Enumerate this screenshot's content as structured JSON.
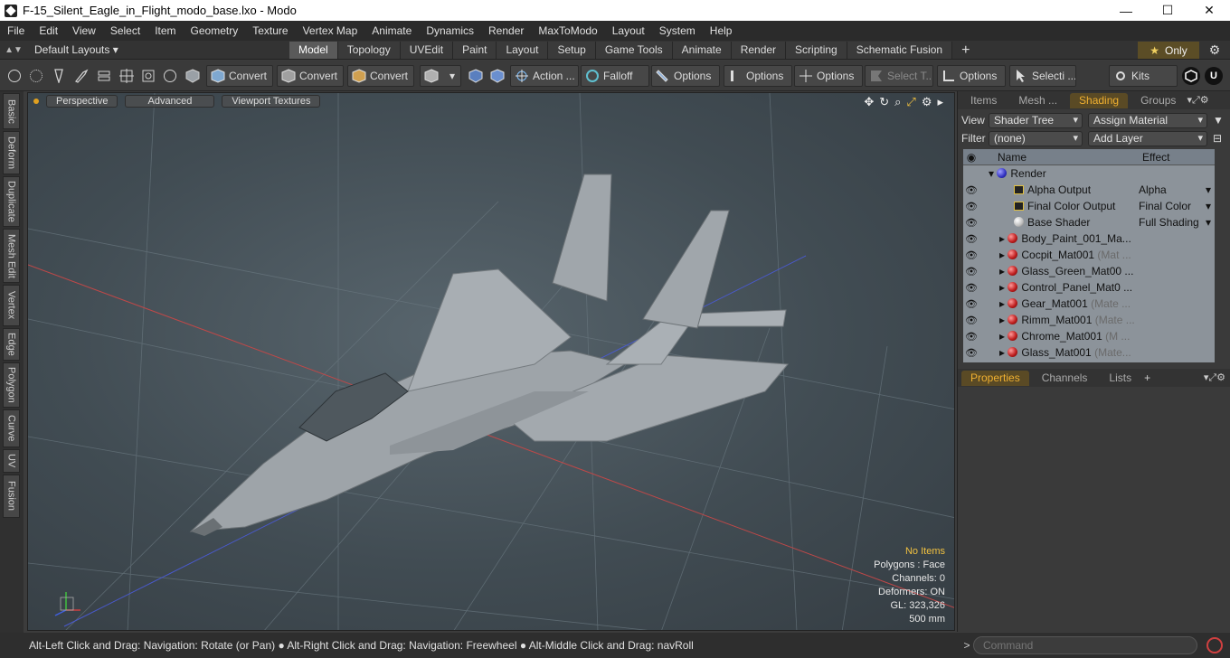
{
  "window": {
    "title": "F-15_Silent_Eagle_in_Flight_modo_base.lxo - Modo",
    "min": "—",
    "max": "☐",
    "close": "✕"
  },
  "menu": [
    "File",
    "Edit",
    "View",
    "Select",
    "Item",
    "Geometry",
    "Texture",
    "Vertex Map",
    "Animate",
    "Dynamics",
    "Render",
    "MaxToModo",
    "Layout",
    "System",
    "Help"
  ],
  "layouts": {
    "selector": "Default Layouts ▾",
    "tabs": [
      "Model",
      "Topology",
      "UVEdit",
      "Paint",
      "Layout",
      "Setup",
      "Game Tools",
      "Animate",
      "Render",
      "Scripting",
      "Schematic Fusion"
    ],
    "active": "Model",
    "only_label": "Only"
  },
  "toolbar": {
    "convert1": "Convert",
    "convert2": "Convert",
    "convert3": "Convert",
    "action": "Action  ...",
    "falloff": "Falloff",
    "options1": "Options",
    "options2": "Options",
    "options3": "Options",
    "select_t": "Select T...",
    "options4": "Options",
    "selecti": "Selecti ...",
    "kits": "Kits"
  },
  "left_tabs": [
    "Basic",
    "Deform",
    "Duplicate",
    "Mesh Edit",
    "Vertex",
    "Edge",
    "Polygon",
    "Curve",
    "UV",
    "Fusion"
  ],
  "viewport": {
    "perspective": "Perspective",
    "advanced": "Advanced",
    "textures": "Viewport Textures",
    "info": {
      "items": "No Items",
      "polygons": "Polygons : Face",
      "channels": "Channels: 0",
      "deformers": "Deformers: ON",
      "gl": "GL: 323,326",
      "scale": "500 mm"
    }
  },
  "status": {
    "hint": "Alt-Left Click and Drag: Navigation: Rotate (or Pan) ● Alt-Right Click and Drag: Navigation: Freewheel ● Alt-Middle Click and Drag: navRoll",
    "command_placeholder": "Command"
  },
  "right_panel": {
    "tabs": [
      "Items",
      "Mesh ...",
      "Shading",
      "Groups"
    ],
    "active_tab": "Shading",
    "view_label": "View",
    "view_value": "Shader Tree",
    "assign_material": "Assign Material",
    "filter_label": "Filter",
    "filter_value": "(none)",
    "add_layer": "Add Layer",
    "col_name": "Name",
    "col_effect": "Effect",
    "rows": [
      {
        "name": "Render",
        "effect": "",
        "icon": "render",
        "indent": 0
      },
      {
        "name": "Alpha Output",
        "effect": "Alpha",
        "icon": "output",
        "indent": 1
      },
      {
        "name": "Final Color Output",
        "effect": "Final Color",
        "icon": "output",
        "indent": 1
      },
      {
        "name": "Base Shader",
        "effect": "Full Shading",
        "icon": "shader",
        "indent": 1
      },
      {
        "name": "Body_Paint_001_Ma...",
        "effect": "",
        "icon": "material",
        "indent": 1
      },
      {
        "name": "Cocpit_Mat001",
        "dim": "(Mat ...",
        "effect": "",
        "icon": "material",
        "indent": 1
      },
      {
        "name": "Glass_Green_Mat00 ...",
        "effect": "",
        "icon": "material",
        "indent": 1
      },
      {
        "name": "Control_Panel_Mat0 ...",
        "effect": "",
        "icon": "material",
        "indent": 1
      },
      {
        "name": "Gear_Mat001",
        "dim": "(Mate ...",
        "effect": "",
        "icon": "material",
        "indent": 1
      },
      {
        "name": "Rimm_Mat001",
        "dim": "(Mate ...",
        "effect": "",
        "icon": "material",
        "indent": 1
      },
      {
        "name": "Chrome_Mat001",
        "dim": "(M ...",
        "effect": "",
        "icon": "material",
        "indent": 1
      },
      {
        "name": "Glass_Mat001",
        "dim": "(Mate...",
        "effect": "",
        "icon": "material",
        "indent": 1
      }
    ],
    "props_tabs": [
      "Properties",
      "Channels",
      "Lists"
    ],
    "props_active": "Properties"
  }
}
